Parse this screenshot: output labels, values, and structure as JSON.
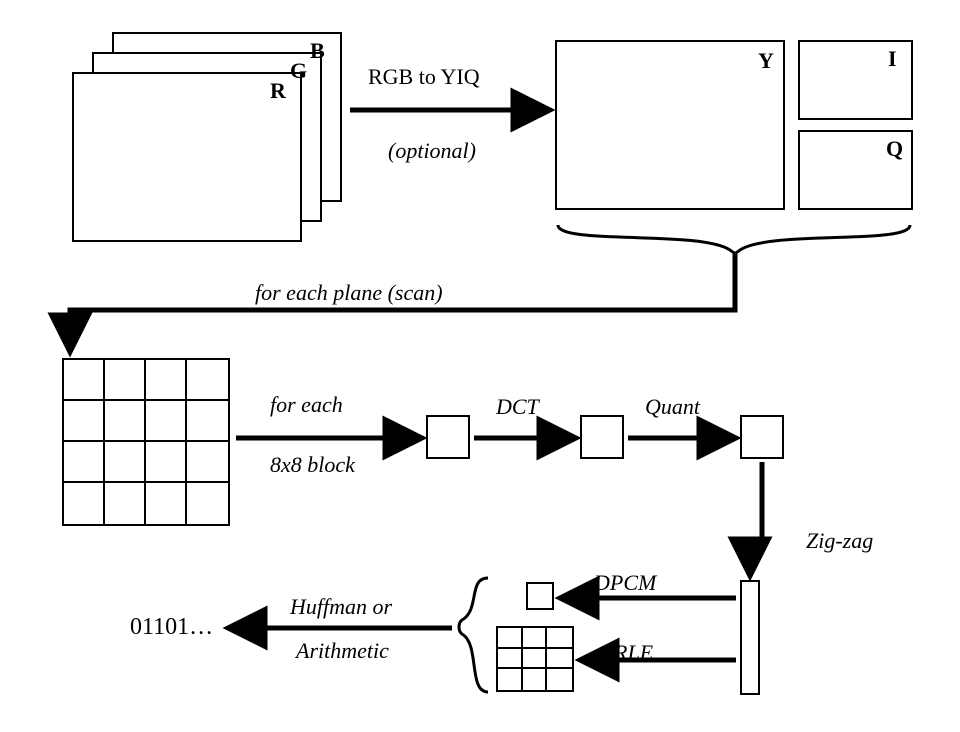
{
  "rgb": {
    "r": "R",
    "g": "G",
    "b": "B"
  },
  "yiq": {
    "y": "Y",
    "i": "I",
    "q": "Q"
  },
  "labels": {
    "rgb_to_yiq": "RGB to YIQ",
    "optional": "(optional)",
    "for_each_plane": "for each plane (scan)",
    "for_each": "for each",
    "block8": "8x8 block",
    "dct": "DCT",
    "quant": "Quant",
    "zigzag": "Zig-zag",
    "dpcm": "DPCM",
    "rle": "RLE",
    "huffman_or": "Huffman or",
    "arithmetic": "Arithmetic"
  },
  "output_bits": "01101…"
}
